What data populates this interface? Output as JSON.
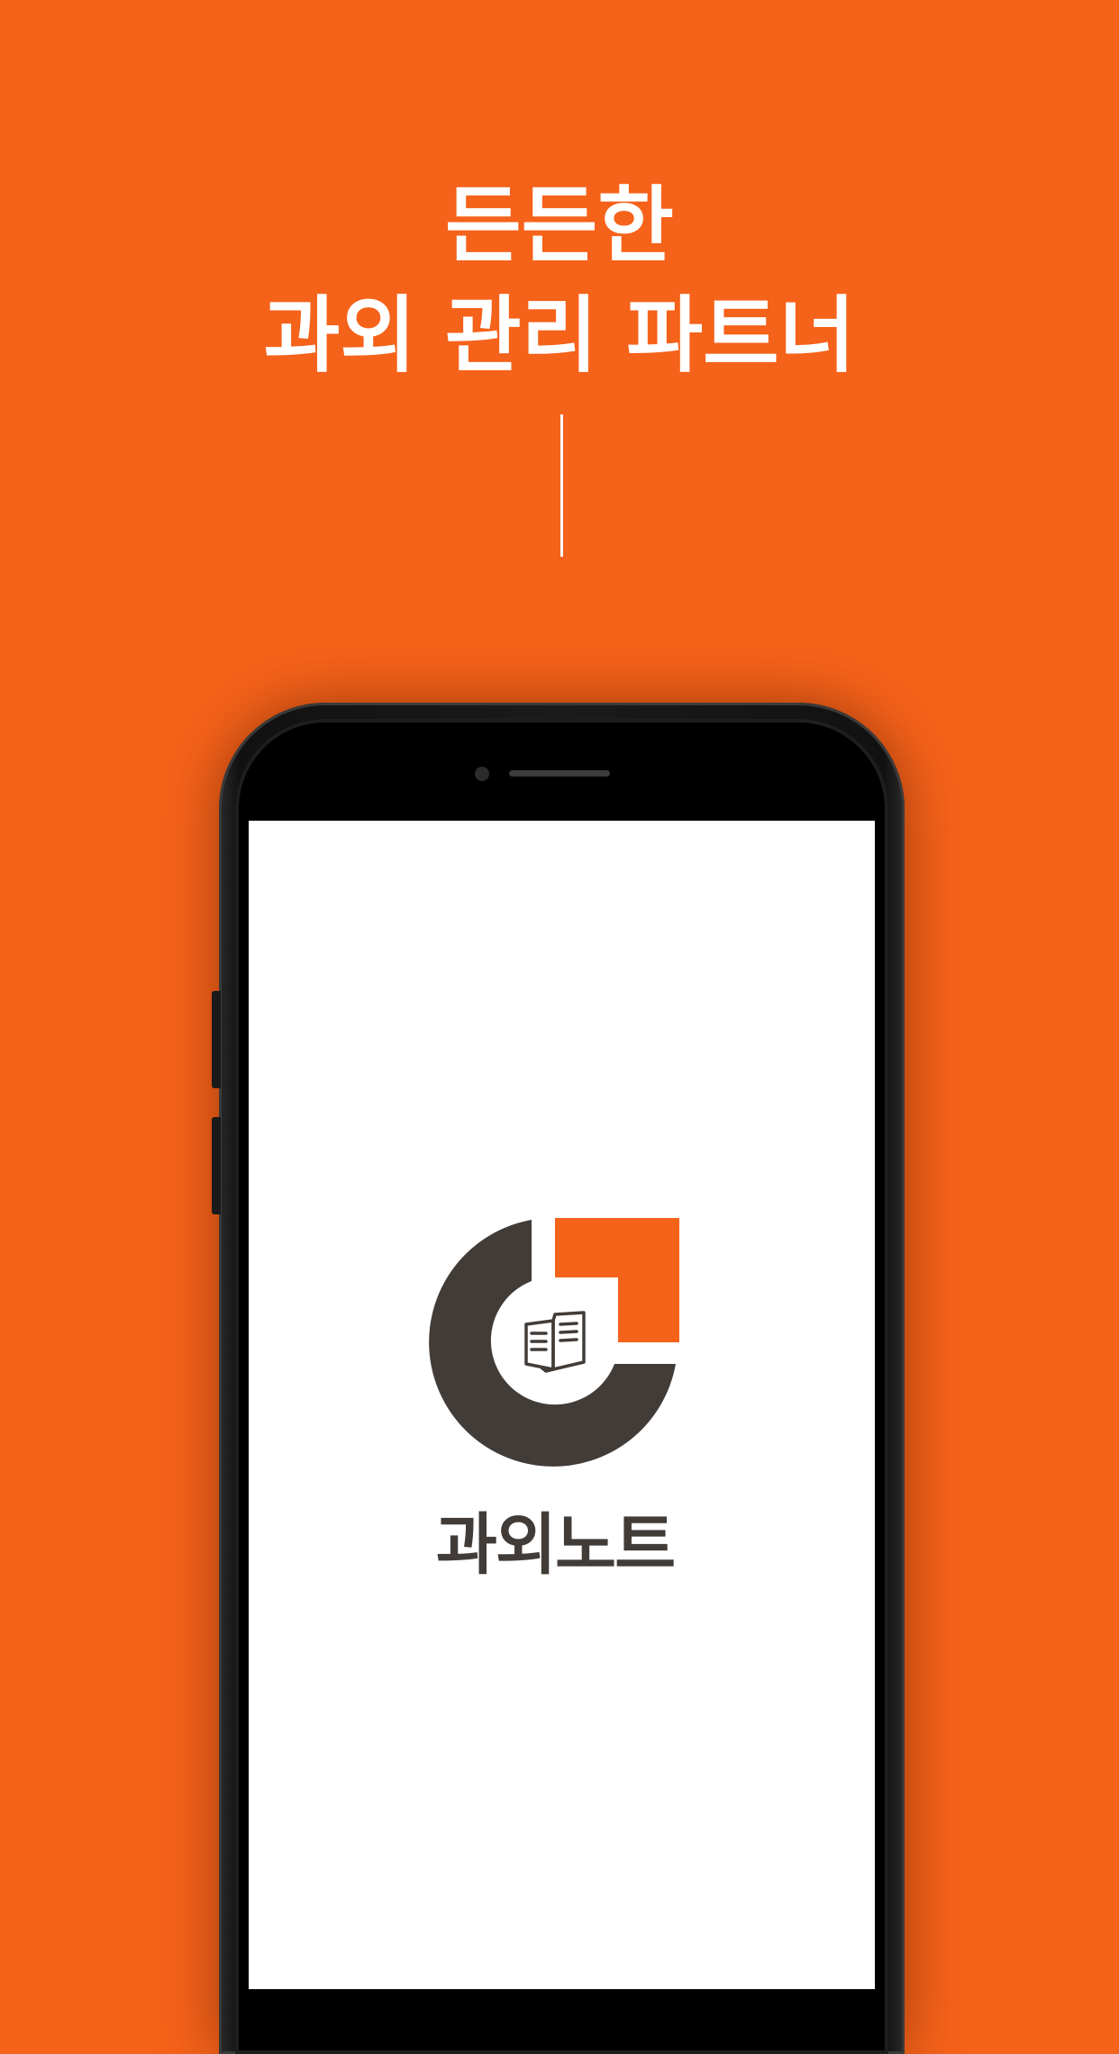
{
  "promo": {
    "headline_line1": "든든한",
    "headline_line2": "과외 관리 파트너"
  },
  "app": {
    "name": "과외노트",
    "logo_icon": "open-book-icon"
  },
  "colors": {
    "background": "#F5621A",
    "logo_dark": "#423C38",
    "logo_accent": "#F5621A",
    "screen": "#FFFFFF"
  }
}
